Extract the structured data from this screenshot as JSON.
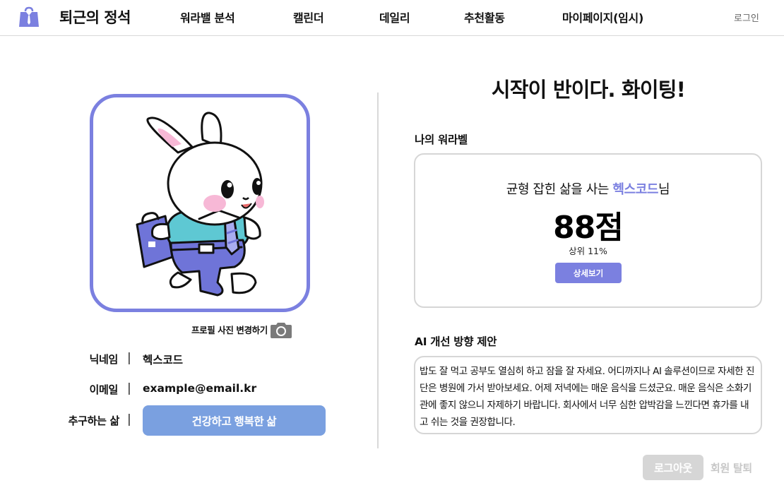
{
  "header": {
    "brand": "퇴근의 정석",
    "logo_icon": "briefcase-logo-icon",
    "nav": [
      "워라밸 분석",
      "캘린더",
      "데일리",
      "추천활동",
      "마이페이지(임시)"
    ],
    "login": "로그인"
  },
  "profile": {
    "avatar_icon": "bunny-office-worker-illustration",
    "photo_change_label": "프로필 사진 변경하기",
    "camera_icon": "camera-icon",
    "nickname_label": "닉네임",
    "nickname": "헥스코드",
    "email_label": "이메일",
    "email": "example@email.kr",
    "goal_label": "추구하는 삶",
    "goal": "건강하고 행복한 삶",
    "separator": "|"
  },
  "headline": "시작이 반이다. 화이팅!",
  "wlb": {
    "section_title": "나의 워라벨",
    "line_prefix": "균형 잡힌 삶을 사는 ",
    "name": "헥스코드",
    "line_suffix": "님",
    "score": "88점",
    "rank": "상위 11%",
    "detail_button": "상세보기"
  },
  "ai": {
    "section_title": "AI 개선 방향 제안",
    "text": "밥도 잘 먹고 공부도 열심히 하고 잠을 잘 자세요. 어디까지나 AI 솔루션이므로 자세한 진단은 병원에 가서 받아보세요. 어제 저녁에는 매운 음식을 드셨군요. 매운 음식은 소화기관에 좋지 않으니 자제하기 바랍니다. 회사에서 너무 심한 압박감을 느낀다면 휴가를 내고 쉬는 것을 권장합니다."
  },
  "footer": {
    "logout": "로그아웃",
    "withdraw": "회원 탈퇴"
  },
  "colors": {
    "accent": "#7b80e0",
    "goal_button": "#7aa0e0",
    "disabled": "#d6d6d6",
    "divider": "#d9d9d9"
  }
}
